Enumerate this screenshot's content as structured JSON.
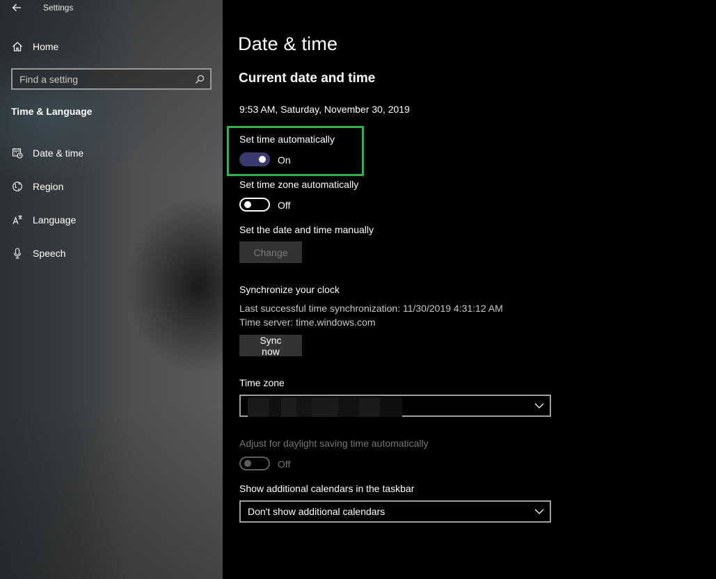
{
  "window": {
    "title": "Settings"
  },
  "sidebar": {
    "home_label": "Home",
    "search_placeholder": "Find a setting",
    "section_label": "Time & Language",
    "items": [
      {
        "label": "Date & time",
        "icon": "calendar-clock-icon",
        "selected": true
      },
      {
        "label": "Region",
        "icon": "globe-icon",
        "selected": false
      },
      {
        "label": "Language",
        "icon": "language-icon",
        "selected": false
      },
      {
        "label": "Speech",
        "icon": "microphone-icon",
        "selected": false
      }
    ]
  },
  "main": {
    "page_title": "Date & time",
    "current_heading": "Current date and time",
    "current_datetime": "9:53 AM, Saturday, November 30, 2019",
    "set_time_auto": {
      "label": "Set time automatically",
      "state": "On"
    },
    "set_zone_auto": {
      "label": "Set time zone automatically",
      "state": "Off"
    },
    "manual": {
      "label": "Set the date and time manually",
      "button": "Change"
    },
    "sync": {
      "heading": "Synchronize your clock",
      "last_sync": "Last successful time synchronization: 11/30/2019 4:31:12 AM",
      "server": "Time server: time.windows.com",
      "button": "Sync now"
    },
    "time_zone": {
      "label": "Time zone",
      "value": ""
    },
    "dst": {
      "label": "Adjust for daylight saving time automatically",
      "state": "Off"
    },
    "calendars": {
      "label": "Show additional calendars in the taskbar",
      "value": "Don't show additional calendars"
    }
  },
  "colors": {
    "toggle_on": "#3b3a6e",
    "highlight": "#2fb24c",
    "background": "#000000"
  }
}
